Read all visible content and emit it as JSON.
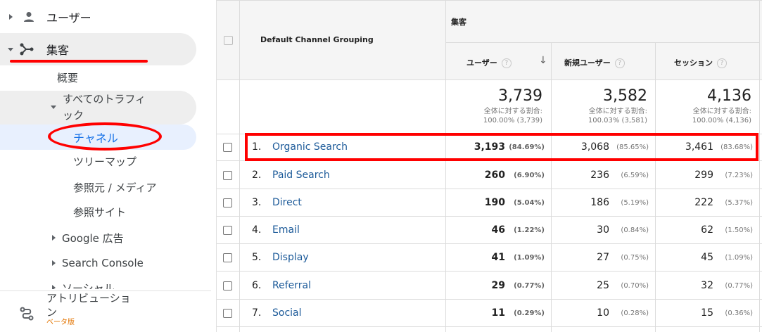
{
  "sidebar": {
    "users": "ユーザー",
    "acquisition": "集客",
    "overview": "概要",
    "all_traffic_line1": "すべてのトラフィ",
    "all_traffic_line2": "ック",
    "channels": "チャネル",
    "treemap": "ツリーマップ",
    "source_medium": "参照元 / メディア",
    "referrals": "参照サイト",
    "google_ads": "Google 広告",
    "search_console": "Search Console",
    "social": "ソーシャル",
    "attribution_line1": "アトリビューショ",
    "attribution_line2": "ン",
    "beta": "ベータ版"
  },
  "table": {
    "dimension_header": "Default Channel Grouping",
    "group_header": "集客",
    "columns": [
      {
        "label": "ユーザー",
        "help": "?"
      },
      {
        "label": "新規ユーザー",
        "help": "?"
      },
      {
        "label": "セッション",
        "help": "?"
      }
    ],
    "sort_icon": "↓",
    "totals": [
      {
        "value": "3,739",
        "line1": "全体に対する割合:",
        "line2": "100.00% (3,739)"
      },
      {
        "value": "3,582",
        "line1": "全体に対する割合:",
        "line2": "100.03% (3,581)"
      },
      {
        "value": "4,136",
        "line1": "全体に対する割合:",
        "line2": "100.00% (4,136)"
      }
    ],
    "rows": [
      {
        "index": "1.",
        "channel": "Organic Search",
        "users": "3,193",
        "users_pct": "(84.69%)",
        "new_users": "3,068",
        "new_users_pct": "(85.65%)",
        "sessions": "3,461",
        "sessions_pct": "(83.68%)"
      },
      {
        "index": "2.",
        "channel": "Paid Search",
        "users": "260",
        "users_pct": "(6.90%)",
        "new_users": "236",
        "new_users_pct": "(6.59%)",
        "sessions": "299",
        "sessions_pct": "(7.23%)"
      },
      {
        "index": "3.",
        "channel": "Direct",
        "users": "190",
        "users_pct": "(5.04%)",
        "new_users": "186",
        "new_users_pct": "(5.19%)",
        "sessions": "222",
        "sessions_pct": "(5.37%)"
      },
      {
        "index": "4.",
        "channel": "Email",
        "users": "46",
        "users_pct": "(1.22%)",
        "new_users": "30",
        "new_users_pct": "(0.84%)",
        "sessions": "62",
        "sessions_pct": "(1.50%)"
      },
      {
        "index": "5.",
        "channel": "Display",
        "users": "41",
        "users_pct": "(1.09%)",
        "new_users": "27",
        "new_users_pct": "(0.75%)",
        "sessions": "45",
        "sessions_pct": "(1.09%)"
      },
      {
        "index": "6.",
        "channel": "Referral",
        "users": "29",
        "users_pct": "(0.77%)",
        "new_users": "25",
        "new_users_pct": "(0.70%)",
        "sessions": "32",
        "sessions_pct": "(0.77%)"
      },
      {
        "index": "7.",
        "channel": "Social",
        "users": "11",
        "users_pct": "(0.29%)",
        "new_users": "10",
        "new_users_pct": "(0.28%)",
        "sessions": "15",
        "sessions_pct": "(0.36%)"
      }
    ]
  },
  "colors": {
    "annotation": "#ff0000",
    "link": "#1c5a99",
    "active": "#1a73e8"
  }
}
